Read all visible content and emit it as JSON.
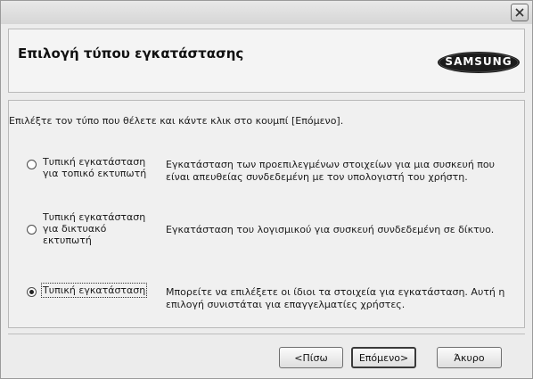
{
  "dialog": {
    "header_title": "Επιλογή τύπου εγκατάστασης",
    "brand": "SAMSUNG",
    "instruction": "Επιλέξτε τον τύπο που θέλετε και κάντε κλικ στο κουμπί [Επόμενο].",
    "options": [
      {
        "label_lines": [
          "Τυπική εγκατάσταση",
          "για τοπικό εκτυπωτή"
        ],
        "desc_lines": [
          "Εγκατάσταση των προεπιλεγμένων στοιχείων για μια συσκευή που",
          "είναι απευθείας συνδεδεμένη με τον υπολογιστή του χρήστη."
        ],
        "selected": false
      },
      {
        "label_lines": [
          "Τυπική εγκατάσταση",
          "για δικτυακό",
          "εκτυπωτή"
        ],
        "desc_lines": [
          "Εγκατάσταση του λογισμικού για συσκευή συνδεδεμένη σε δίκτυο."
        ],
        "selected": false
      },
      {
        "label_lines": [
          "Τυπική εγκατάσταση"
        ],
        "desc_lines": [
          "Μπορείτε να επιλέξετε οι ίδιοι τα στοιχεία για εγκατάσταση. Αυτή η",
          "επιλογή συνιστάται για επαγγελματίες χρήστες."
        ],
        "selected": true
      }
    ],
    "buttons": {
      "back": "<Πίσω",
      "next": "Επόμενο>",
      "cancel": "Άκυρο"
    }
  },
  "icons": {
    "close": "close-icon",
    "radio": "radio-button"
  },
  "colors": {
    "window_bg": "#ececec",
    "panel_bg": "#f4f4f4",
    "border": "#b9b9b9"
  }
}
